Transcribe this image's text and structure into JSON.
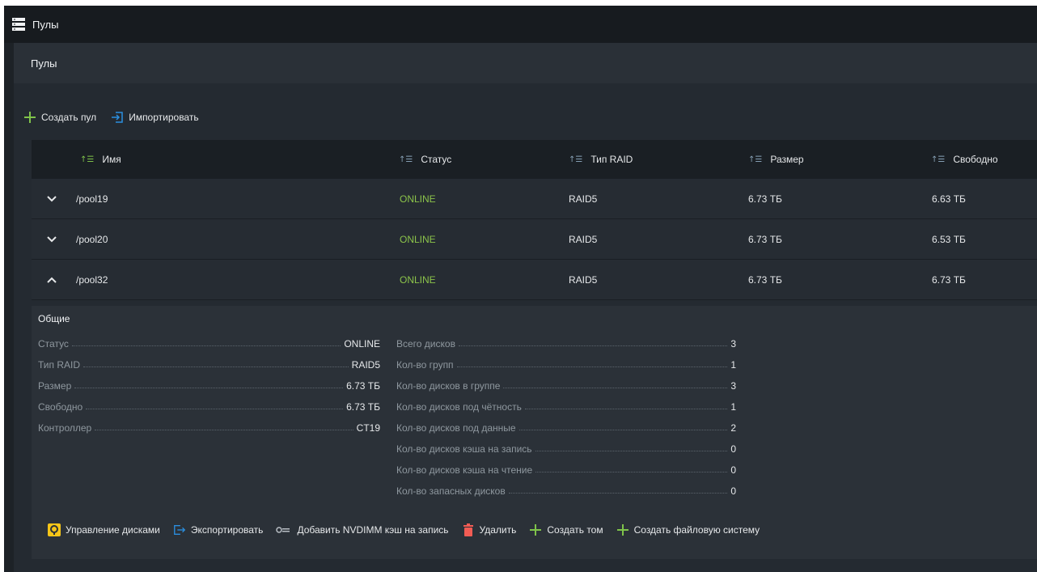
{
  "app": {
    "title": "Пулы",
    "icon": "server-stack-icon"
  },
  "panel": {
    "title": "Пулы"
  },
  "toolbar": {
    "create_pool": "Создать пул",
    "import": "Импортировать"
  },
  "columns": [
    "Имя",
    "Статус",
    "Тип RAID",
    "Размер",
    "Свободно"
  ],
  "pools": [
    {
      "name": "/pool19",
      "status": "ONLINE",
      "raid": "RAID5",
      "size": "6.73 ТБ",
      "free": "6.63 ТБ",
      "expanded": false
    },
    {
      "name": "/pool20",
      "status": "ONLINE",
      "raid": "RAID5",
      "size": "6.73 ТБ",
      "free": "6.53 ТБ",
      "expanded": false
    },
    {
      "name": "/pool32",
      "status": "ONLINE",
      "raid": "RAID5",
      "size": "6.73 ТБ",
      "free": "6.73 ТБ",
      "expanded": true
    }
  ],
  "details": {
    "title": "Общие",
    "left": [
      {
        "key": "Статус",
        "value": "ONLINE"
      },
      {
        "key": "Тип RAID",
        "value": "RAID5"
      },
      {
        "key": "Размер",
        "value": "6.73 ТБ"
      },
      {
        "key": "Свободно",
        "value": "6.73 ТБ"
      },
      {
        "key": "Контроллер",
        "value": "CT19"
      }
    ],
    "right": [
      {
        "key": "Всего дисков",
        "value": "3"
      },
      {
        "key": "Кол-во групп",
        "value": "1"
      },
      {
        "key": "Кол-во дисков в группе",
        "value": "3"
      },
      {
        "key": "Кол-во дисков под чётность",
        "value": "1"
      },
      {
        "key": "Кол-во дисков под данные",
        "value": "2"
      },
      {
        "key": "Кол-во дисков кэша на запись",
        "value": "0"
      },
      {
        "key": "Кол-во дисков кэша на чтение",
        "value": "0"
      },
      {
        "key": "Кол-во запасных дисков",
        "value": "0"
      }
    ],
    "actions": {
      "manage_disks": "Управление дисками",
      "export": "Экспортировать",
      "add_nvdimm": "Добавить NVDIMM кэш на запись",
      "delete": "Удалить",
      "create_volume": "Создать том",
      "create_fs": "Создать файловую систему"
    }
  },
  "colors": {
    "online": "#8bc34a",
    "add": "#7fc34a",
    "accent_blue": "#2b8fe0",
    "delete": "#f25c54",
    "disk_yellow": "#f5c518"
  }
}
